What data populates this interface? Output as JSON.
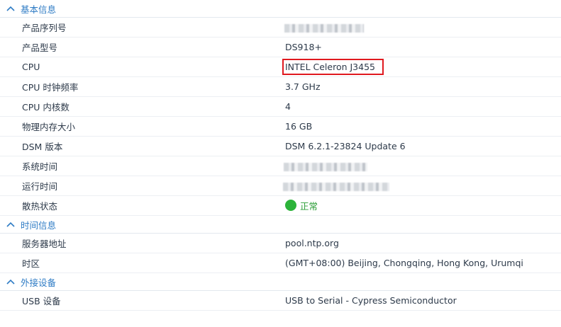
{
  "sections": {
    "basic": {
      "title": "基本信息",
      "rows": {
        "serial": {
          "label": "产品序列号",
          "value": ""
        },
        "model": {
          "label": "产品型号",
          "value": "DS918+"
        },
        "cpu": {
          "label": "CPU",
          "value": "INTEL Celeron J3455"
        },
        "cpu_freq": {
          "label": "CPU 时钟频率",
          "value": "3.7 GHz"
        },
        "cpu_cores": {
          "label": "CPU 内核数",
          "value": "4"
        },
        "memory": {
          "label": "物理内存大小",
          "value": "16 GB"
        },
        "dsm": {
          "label": "DSM 版本",
          "value": "DSM 6.2.1-23824 Update 6"
        },
        "system_time": {
          "label": "系统时间",
          "value": ""
        },
        "uptime": {
          "label": "运行时间",
          "value": ""
        },
        "thermal": {
          "label": "散热状态",
          "value": "正常",
          "status_color": "#2cb33a"
        }
      }
    },
    "time": {
      "title": "时间信息",
      "rows": {
        "server": {
          "label": "服务器地址",
          "value": "pool.ntp.org"
        },
        "timezone": {
          "label": "时区",
          "value": "(GMT+08:00) Beijing, Chongqing, Hong Kong, Urumqi"
        }
      }
    },
    "external": {
      "title": "外接设备",
      "rows": {
        "usb": {
          "label": "USB 设备",
          "value": "USB to Serial - Cypress Semiconductor"
        }
      }
    }
  },
  "colors": {
    "section_title": "#2f7cc5",
    "highlight_border": "#e0191f",
    "status_ok": "#2cb33a"
  },
  "icons": {
    "collapse": "chevron-up-icon",
    "status": "status-ok-icon"
  }
}
